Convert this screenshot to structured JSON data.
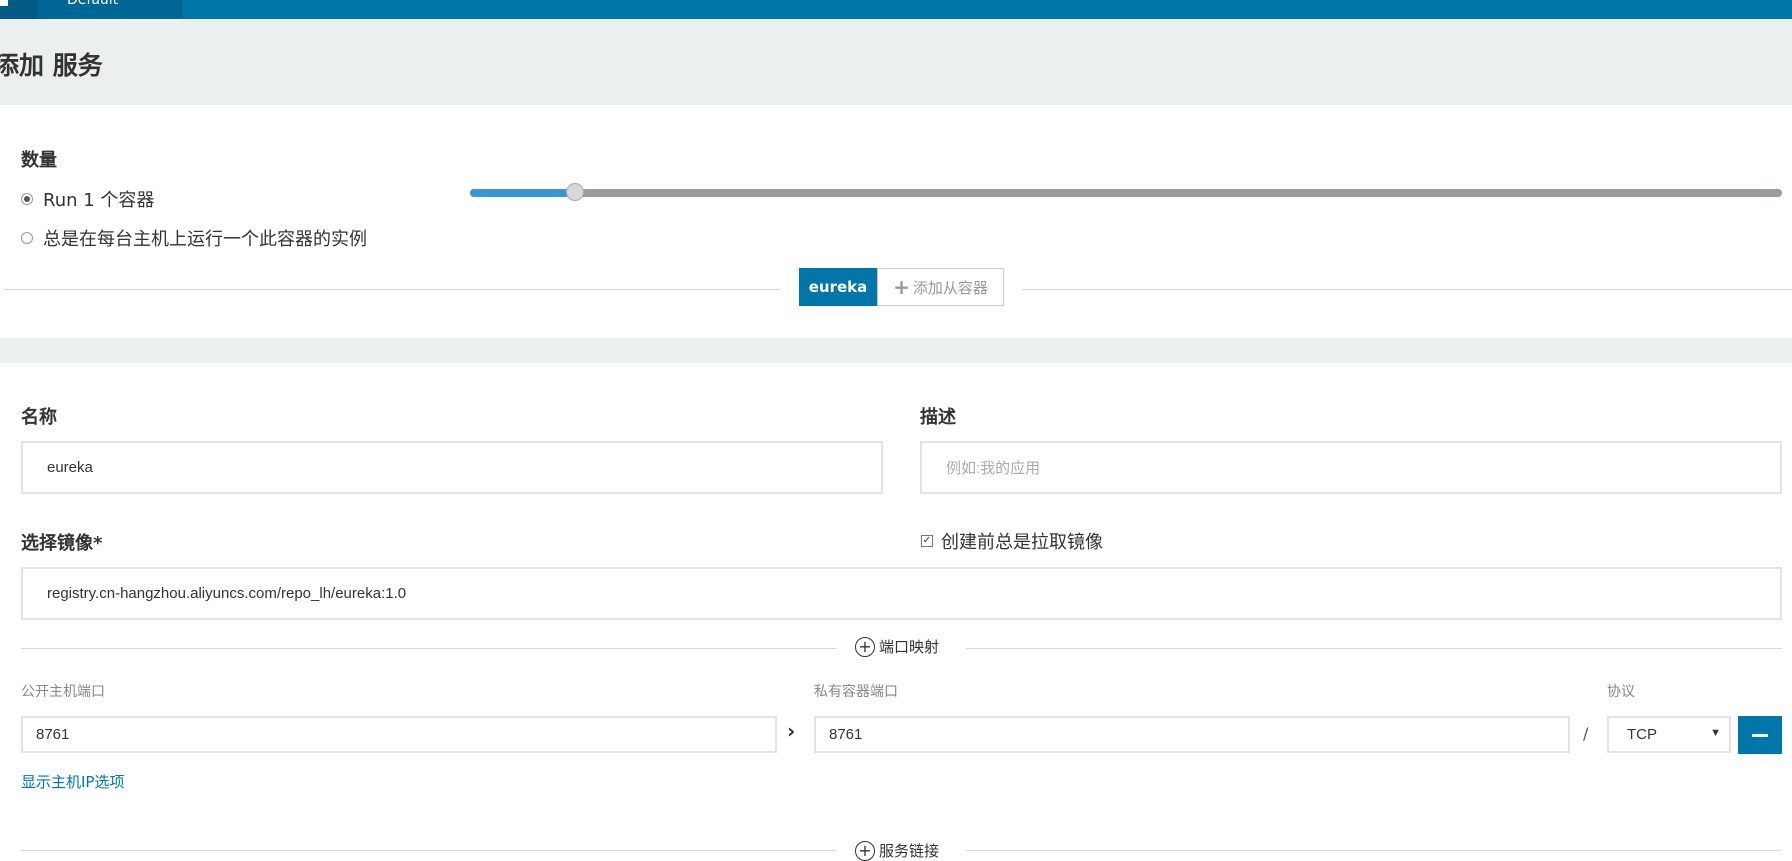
{
  "topbar": {
    "tab_label": "Default"
  },
  "page": {
    "title": "添加 服务"
  },
  "scale": {
    "label": "数量",
    "option_run": "Run 1 个容器",
    "option_global": "总是在每台主机上运行一个此容器的实例",
    "slider_value_fraction": 0.08
  },
  "container_tabs": {
    "active": "eureka",
    "add_sidekick": "添加从容器"
  },
  "form": {
    "name_label": "名称",
    "name_value": "eureka",
    "desc_label": "描述",
    "desc_placeholder": "例如:我的应用",
    "image_label": "选择镜像*",
    "pull_label": "创建前总是拉取镜像",
    "pull_checked": true,
    "image_value": "registry.cn-hangzhou.aliyuncs.com/repo_lh/eureka:1.0"
  },
  "ports": {
    "section": "端口映射",
    "public_label": "公开主机端口",
    "private_label": "私有容器端口",
    "protocol_label": "协议",
    "public_value": "8761",
    "private_value": "8761",
    "protocol_value": "TCP",
    "show_ip_link": "显示主机IP选项"
  },
  "links": {
    "section": "服务链接"
  },
  "colors": {
    "brand": "#0075a8",
    "slider_fill": "#3b95d3",
    "band": "#ebeff0"
  }
}
